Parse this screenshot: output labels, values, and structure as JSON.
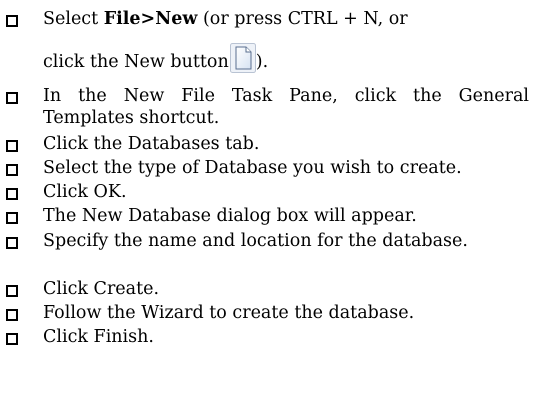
{
  "steps": [
    {
      "pre": "Select ",
      "bold": "File>New",
      "post": " (or press CTRL + N, or"
    },
    {
      "line2": "click the New button",
      "tail": ")."
    },
    {
      "text": "In the New File Task Pane, click the General Templates shortcut."
    },
    {
      "text": "Click the Databases tab."
    },
    {
      "text": "Select the type of Database you wish to create."
    },
    {
      "text": "Click OK."
    },
    {
      "text": "The New Database dialog box will appear."
    },
    {
      "text": "Specify the name and location for the database."
    },
    {
      "text": "Click Create."
    },
    {
      "text": "Follow the Wizard to create the database."
    },
    {
      "text": "Click Finish."
    }
  ],
  "icon": "new-document-icon"
}
